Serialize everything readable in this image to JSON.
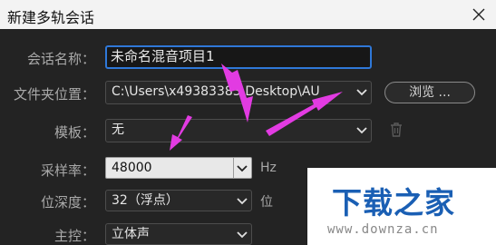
{
  "window": {
    "title": "新建多轨会话",
    "close_icon": "close-icon"
  },
  "form": {
    "session_name": {
      "label": "会话名称：",
      "value": "未命名混音项目1"
    },
    "folder": {
      "label": "文件夹位置：",
      "value": "C:\\Users\\x49383383\\Desktop\\AU",
      "browse_label": "浏览 ..."
    },
    "template": {
      "label": "模板：",
      "value": "无"
    },
    "sample_rate": {
      "label": "采样率：",
      "value": "48000",
      "unit": "Hz"
    },
    "bit_depth": {
      "label": "位深度：",
      "value": "32（浮点）",
      "unit": "位"
    },
    "master": {
      "label": "主控：",
      "value": "立体声"
    }
  },
  "watermark": {
    "title": "下载之家",
    "url": "www.downza.cn"
  },
  "colors": {
    "dialog_bg": "#232323",
    "focus_border": "#2f78d8",
    "annotation_arrow": "#e23be2",
    "watermark_blue": "#1a5fb4"
  }
}
